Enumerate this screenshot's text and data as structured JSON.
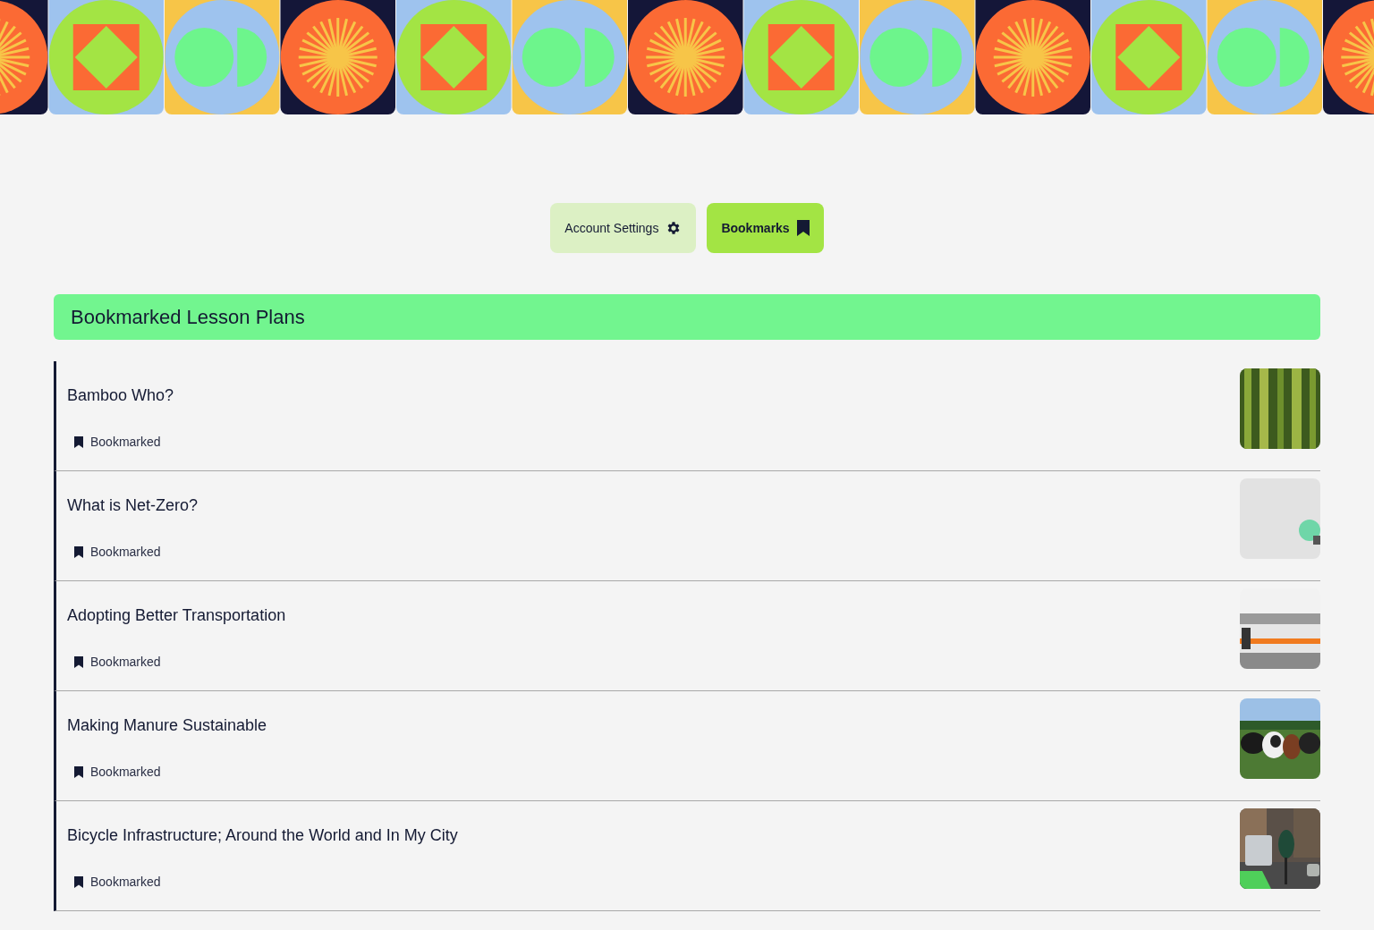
{
  "tabs": [
    {
      "label": "Account Settings",
      "selected": false
    },
    {
      "label": "Bookmarks",
      "selected": true
    }
  ],
  "section_title": "Bookmarked Lesson Plans",
  "lessons": [
    {
      "title": "Bamboo Who?",
      "status": "Bookmarked"
    },
    {
      "title": "What is Net-Zero?",
      "status": "Bookmarked"
    },
    {
      "title": "Adopting Better Transportation",
      "status": "Bookmarked"
    },
    {
      "title": "Making Manure Sustainable",
      "status": "Bookmarked"
    },
    {
      "title": "Bicycle Infrastructure; Around the World and In My City",
      "status": "Bookmarked"
    }
  ]
}
